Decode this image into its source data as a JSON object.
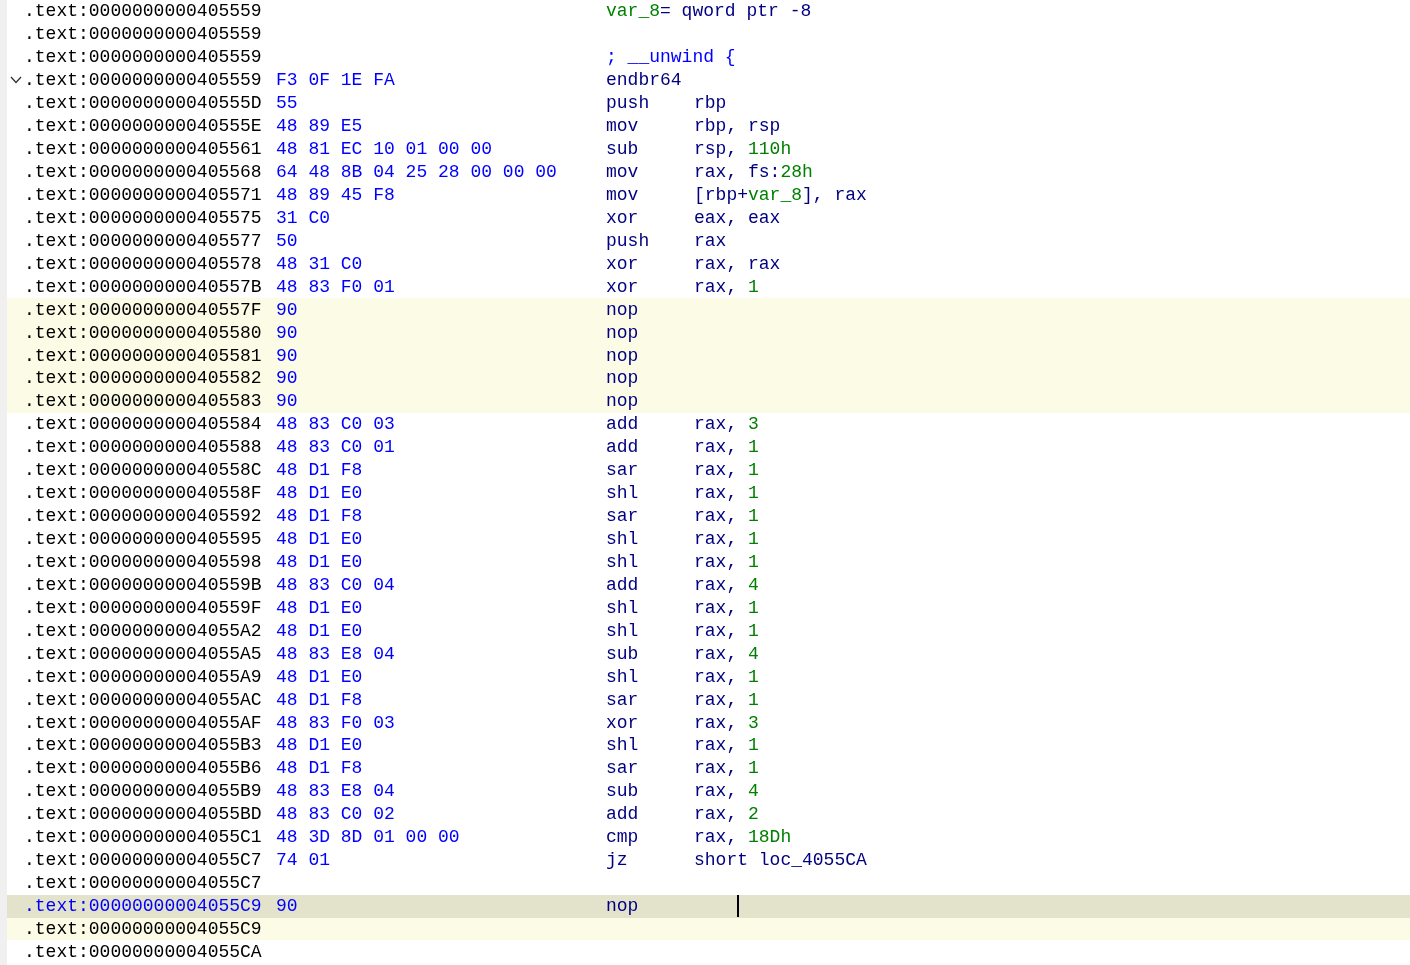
{
  "listing": [
    {
      "address": ".text:0000000000405559",
      "code": [
        {
          "text": "var_8",
          "kind": "name"
        },
        {
          "text": "= qword ptr -8",
          "kind": "plain"
        }
      ],
      "highlighted": false,
      "selected": false,
      "fold": false
    },
    {
      "address": ".text:0000000000405559",
      "highlighted": false,
      "selected": false,
      "fold": false
    },
    {
      "address": ".text:0000000000405559",
      "code": [
        {
          "text": "; __unwind {",
          "kind": "comment"
        }
      ],
      "highlighted": false,
      "selected": false,
      "fold": false
    },
    {
      "address": ".text:0000000000405559",
      "bytes": "F3 0F 1E FA",
      "mnemonic": "endbr64",
      "highlighted": false,
      "selected": false,
      "fold": true
    },
    {
      "address": ".text:000000000040555D",
      "bytes": "55",
      "mnemonic": "push",
      "code": [
        {
          "text": "rbp",
          "kind": "plain"
        }
      ],
      "highlighted": false,
      "selected": false,
      "fold": false
    },
    {
      "address": ".text:000000000040555E",
      "bytes": "48 89 E5",
      "mnemonic": "mov",
      "code": [
        {
          "text": "rbp, rsp",
          "kind": "plain"
        }
      ],
      "highlighted": false,
      "selected": false,
      "fold": false
    },
    {
      "address": ".text:0000000000405561",
      "bytes": "48 81 EC 10 01 00 00",
      "mnemonic": "sub",
      "code": [
        {
          "text": "rsp, ",
          "kind": "plain"
        },
        {
          "text": "110h",
          "kind": "num"
        }
      ],
      "highlighted": false,
      "selected": false,
      "fold": false
    },
    {
      "address": ".text:0000000000405568",
      "bytes": "64 48 8B 04 25 28 00 00 00",
      "mnemonic": "mov",
      "code": [
        {
          "text": "rax, fs:",
          "kind": "plain"
        },
        {
          "text": "28h",
          "kind": "num"
        }
      ],
      "highlighted": false,
      "selected": false,
      "fold": false
    },
    {
      "address": ".text:0000000000405571",
      "bytes": "48 89 45 F8",
      "mnemonic": "mov",
      "code": [
        {
          "text": "[rbp+",
          "kind": "plain"
        },
        {
          "text": "var_8",
          "kind": "name"
        },
        {
          "text": "], rax",
          "kind": "plain"
        }
      ],
      "highlighted": false,
      "selected": false,
      "fold": false
    },
    {
      "address": ".text:0000000000405575",
      "bytes": "31 C0",
      "mnemonic": "xor",
      "code": [
        {
          "text": "eax, eax",
          "kind": "plain"
        }
      ],
      "highlighted": false,
      "selected": false,
      "fold": false
    },
    {
      "address": ".text:0000000000405577",
      "bytes": "50",
      "mnemonic": "push",
      "code": [
        {
          "text": "rax",
          "kind": "plain"
        }
      ],
      "highlighted": false,
      "selected": false,
      "fold": false
    },
    {
      "address": ".text:0000000000405578",
      "bytes": "48 31 C0",
      "mnemonic": "xor",
      "code": [
        {
          "text": "rax, rax",
          "kind": "plain"
        }
      ],
      "highlighted": false,
      "selected": false,
      "fold": false
    },
    {
      "address": ".text:000000000040557B",
      "bytes": "48 83 F0 01",
      "mnemonic": "xor",
      "code": [
        {
          "text": "rax, ",
          "kind": "plain"
        },
        {
          "text": "1",
          "kind": "num"
        }
      ],
      "highlighted": false,
      "selected": false,
      "fold": false
    },
    {
      "address": ".text:000000000040557F",
      "bytes": "90",
      "mnemonic": "nop",
      "highlighted": true,
      "selected": false,
      "fold": false
    },
    {
      "address": ".text:0000000000405580",
      "bytes": "90",
      "mnemonic": "nop",
      "highlighted": true,
      "selected": false,
      "fold": false
    },
    {
      "address": ".text:0000000000405581",
      "bytes": "90",
      "mnemonic": "nop",
      "highlighted": true,
      "selected": false,
      "fold": false
    },
    {
      "address": ".text:0000000000405582",
      "bytes": "90",
      "mnemonic": "nop",
      "highlighted": true,
      "selected": false,
      "fold": false
    },
    {
      "address": ".text:0000000000405583",
      "bytes": "90",
      "mnemonic": "nop",
      "highlighted": true,
      "selected": false,
      "fold": false
    },
    {
      "address": ".text:0000000000405584",
      "bytes": "48 83 C0 03",
      "mnemonic": "add",
      "code": [
        {
          "text": "rax, ",
          "kind": "plain"
        },
        {
          "text": "3",
          "kind": "num"
        }
      ],
      "highlighted": false,
      "selected": false,
      "fold": false
    },
    {
      "address": ".text:0000000000405588",
      "bytes": "48 83 C0 01",
      "mnemonic": "add",
      "code": [
        {
          "text": "rax, ",
          "kind": "plain"
        },
        {
          "text": "1",
          "kind": "num"
        }
      ],
      "highlighted": false,
      "selected": false,
      "fold": false
    },
    {
      "address": ".text:000000000040558C",
      "bytes": "48 D1 F8",
      "mnemonic": "sar",
      "code": [
        {
          "text": "rax, ",
          "kind": "plain"
        },
        {
          "text": "1",
          "kind": "num"
        }
      ],
      "highlighted": false,
      "selected": false,
      "fold": false
    },
    {
      "address": ".text:000000000040558F",
      "bytes": "48 D1 E0",
      "mnemonic": "shl",
      "code": [
        {
          "text": "rax, ",
          "kind": "plain"
        },
        {
          "text": "1",
          "kind": "num"
        }
      ],
      "highlighted": false,
      "selected": false,
      "fold": false
    },
    {
      "address": ".text:0000000000405592",
      "bytes": "48 D1 F8",
      "mnemonic": "sar",
      "code": [
        {
          "text": "rax, ",
          "kind": "plain"
        },
        {
          "text": "1",
          "kind": "num"
        }
      ],
      "highlighted": false,
      "selected": false,
      "fold": false
    },
    {
      "address": ".text:0000000000405595",
      "bytes": "48 D1 E0",
      "mnemonic": "shl",
      "code": [
        {
          "text": "rax, ",
          "kind": "plain"
        },
        {
          "text": "1",
          "kind": "num"
        }
      ],
      "highlighted": false,
      "selected": false,
      "fold": false
    },
    {
      "address": ".text:0000000000405598",
      "bytes": "48 D1 E0",
      "mnemonic": "shl",
      "code": [
        {
          "text": "rax, ",
          "kind": "plain"
        },
        {
          "text": "1",
          "kind": "num"
        }
      ],
      "highlighted": false,
      "selected": false,
      "fold": false
    },
    {
      "address": ".text:000000000040559B",
      "bytes": "48 83 C0 04",
      "mnemonic": "add",
      "code": [
        {
          "text": "rax, ",
          "kind": "plain"
        },
        {
          "text": "4",
          "kind": "num"
        }
      ],
      "highlighted": false,
      "selected": false,
      "fold": false
    },
    {
      "address": ".text:000000000040559F",
      "bytes": "48 D1 E0",
      "mnemonic": "shl",
      "code": [
        {
          "text": "rax, ",
          "kind": "plain"
        },
        {
          "text": "1",
          "kind": "num"
        }
      ],
      "highlighted": false,
      "selected": false,
      "fold": false
    },
    {
      "address": ".text:00000000004055A2",
      "bytes": "48 D1 E0",
      "mnemonic": "shl",
      "code": [
        {
          "text": "rax, ",
          "kind": "plain"
        },
        {
          "text": "1",
          "kind": "num"
        }
      ],
      "highlighted": false,
      "selected": false,
      "fold": false
    },
    {
      "address": ".text:00000000004055A5",
      "bytes": "48 83 E8 04",
      "mnemonic": "sub",
      "code": [
        {
          "text": "rax, ",
          "kind": "plain"
        },
        {
          "text": "4",
          "kind": "num"
        }
      ],
      "highlighted": false,
      "selected": false,
      "fold": false
    },
    {
      "address": ".text:00000000004055A9",
      "bytes": "48 D1 E0",
      "mnemonic": "shl",
      "code": [
        {
          "text": "rax, ",
          "kind": "plain"
        },
        {
          "text": "1",
          "kind": "num"
        }
      ],
      "highlighted": false,
      "selected": false,
      "fold": false
    },
    {
      "address": ".text:00000000004055AC",
      "bytes": "48 D1 F8",
      "mnemonic": "sar",
      "code": [
        {
          "text": "rax, ",
          "kind": "plain"
        },
        {
          "text": "1",
          "kind": "num"
        }
      ],
      "highlighted": false,
      "selected": false,
      "fold": false
    },
    {
      "address": ".text:00000000004055AF",
      "bytes": "48 83 F0 03",
      "mnemonic": "xor",
      "code": [
        {
          "text": "rax, ",
          "kind": "plain"
        },
        {
          "text": "3",
          "kind": "num"
        }
      ],
      "highlighted": false,
      "selected": false,
      "fold": false
    },
    {
      "address": ".text:00000000004055B3",
      "bytes": "48 D1 E0",
      "mnemonic": "shl",
      "code": [
        {
          "text": "rax, ",
          "kind": "plain"
        },
        {
          "text": "1",
          "kind": "num"
        }
      ],
      "highlighted": false,
      "selected": false,
      "fold": false
    },
    {
      "address": ".text:00000000004055B6",
      "bytes": "48 D1 F8",
      "mnemonic": "sar",
      "code": [
        {
          "text": "rax, ",
          "kind": "plain"
        },
        {
          "text": "1",
          "kind": "num"
        }
      ],
      "highlighted": false,
      "selected": false,
      "fold": false
    },
    {
      "address": ".text:00000000004055B9",
      "bytes": "48 83 E8 04",
      "mnemonic": "sub",
      "code": [
        {
          "text": "rax, ",
          "kind": "plain"
        },
        {
          "text": "4",
          "kind": "num"
        }
      ],
      "highlighted": false,
      "selected": false,
      "fold": false
    },
    {
      "address": ".text:00000000004055BD",
      "bytes": "48 83 C0 02",
      "mnemonic": "add",
      "code": [
        {
          "text": "rax, ",
          "kind": "plain"
        },
        {
          "text": "2",
          "kind": "num"
        }
      ],
      "highlighted": false,
      "selected": false,
      "fold": false
    },
    {
      "address": ".text:00000000004055C1",
      "bytes": "48 3D 8D 01 00 00",
      "mnemonic": "cmp",
      "code": [
        {
          "text": "rax, ",
          "kind": "plain"
        },
        {
          "text": "18Dh",
          "kind": "num"
        }
      ],
      "highlighted": false,
      "selected": false,
      "fold": false
    },
    {
      "address": ".text:00000000004055C7",
      "bytes": "74 01",
      "mnemonic": "jz",
      "code": [
        {
          "text": "short loc_4055CA",
          "kind": "plain"
        }
      ],
      "highlighted": false,
      "selected": false,
      "fold": false
    },
    {
      "address": ".text:00000000004055C7",
      "highlighted": false,
      "selected": false,
      "fold": false
    },
    {
      "address": ".text:00000000004055C9",
      "bytes": "90",
      "mnemonic": "nop",
      "highlighted": false,
      "selected": true,
      "fold": false
    },
    {
      "address": ".text:00000000004055C9",
      "highlighted": true,
      "selected": false,
      "fold": false
    },
    {
      "address": ".text:00000000004055CA",
      "highlighted": false,
      "selected": false,
      "fold": false
    }
  ]
}
